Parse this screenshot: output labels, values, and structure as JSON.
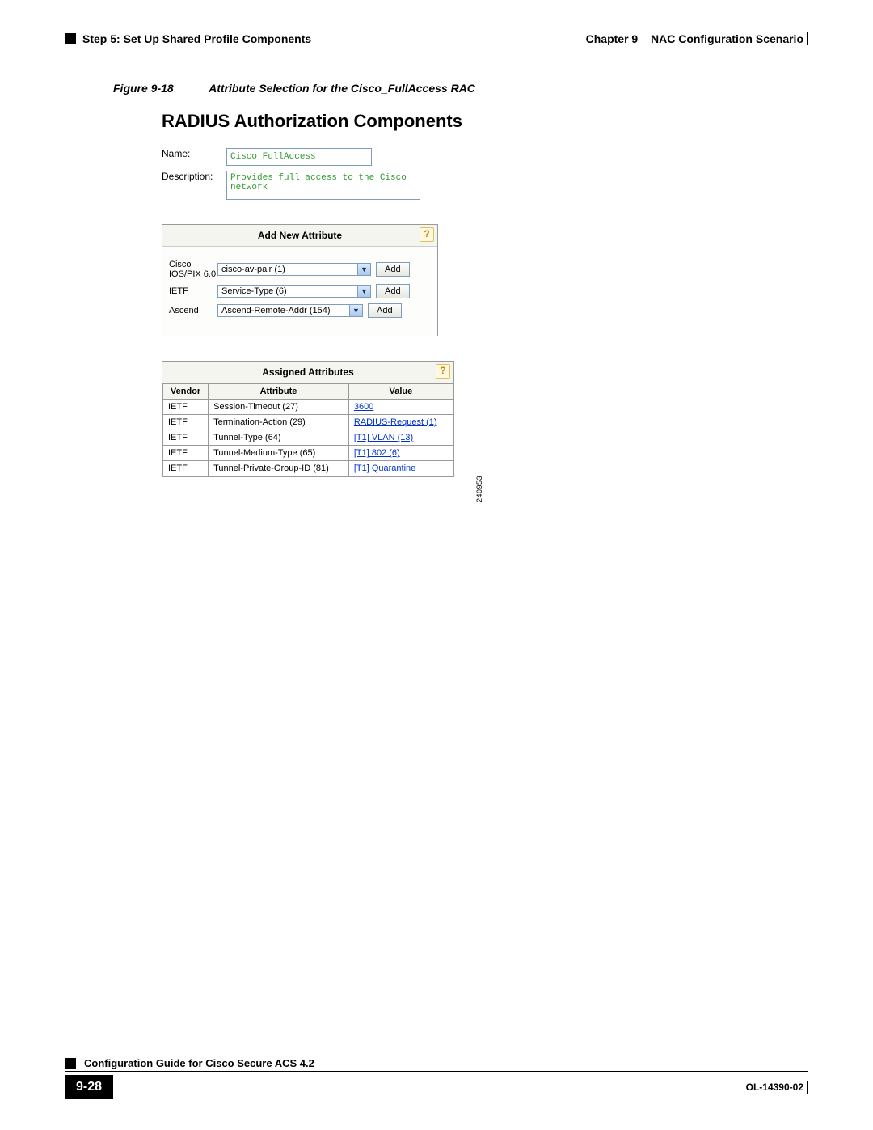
{
  "header": {
    "left": "Step 5: Set Up Shared Profile Components",
    "right_chapter": "Chapter 9",
    "right_title": "NAC Configuration Scenario"
  },
  "figure": {
    "label": "Figure 9-18",
    "caption": "Attribute Selection for the Cisco_FullAccess RAC",
    "id_code": "240953"
  },
  "rac": {
    "title": "RADIUS Authorization Components",
    "name_label": "Name:",
    "name_value": "Cisco_FullAccess",
    "desc_label": "Description:",
    "desc_value": "Provides full access to the Cisco network"
  },
  "add_panel": {
    "title": "Add New Attribute",
    "help": "?",
    "rows": [
      {
        "label": "Cisco IOS/PIX 6.0",
        "option": "cisco-av-pair (1)",
        "btn": "Add"
      },
      {
        "label": "IETF",
        "option": "Service-Type (6)",
        "btn": "Add"
      },
      {
        "label": "Ascend",
        "option": "Ascend-Remote-Addr (154)",
        "btn": "Add"
      }
    ]
  },
  "assigned_panel": {
    "title": "Assigned Attributes",
    "help": "?",
    "cols": {
      "vendor": "Vendor",
      "attribute": "Attribute",
      "value": "Value"
    },
    "rows": [
      {
        "vendor": "IETF",
        "attribute": "Session-Timeout (27)",
        "value": "3600"
      },
      {
        "vendor": "IETF",
        "attribute": "Termination-Action (29)",
        "value": "RADIUS-Request (1)"
      },
      {
        "vendor": "IETF",
        "attribute": "Tunnel-Type (64)",
        "value": "[T1] VLAN (13)"
      },
      {
        "vendor": "IETF",
        "attribute": "Tunnel-Medium-Type (65)",
        "value": "[T1] 802 (6)"
      },
      {
        "vendor": "IETF",
        "attribute": "Tunnel-Private-Group-ID (81)",
        "value": "[T1] Quarantine"
      }
    ]
  },
  "footer": {
    "guide": "Configuration Guide for Cisco Secure ACS 4.2",
    "page": "9-28",
    "docid": "OL-14390-02"
  }
}
